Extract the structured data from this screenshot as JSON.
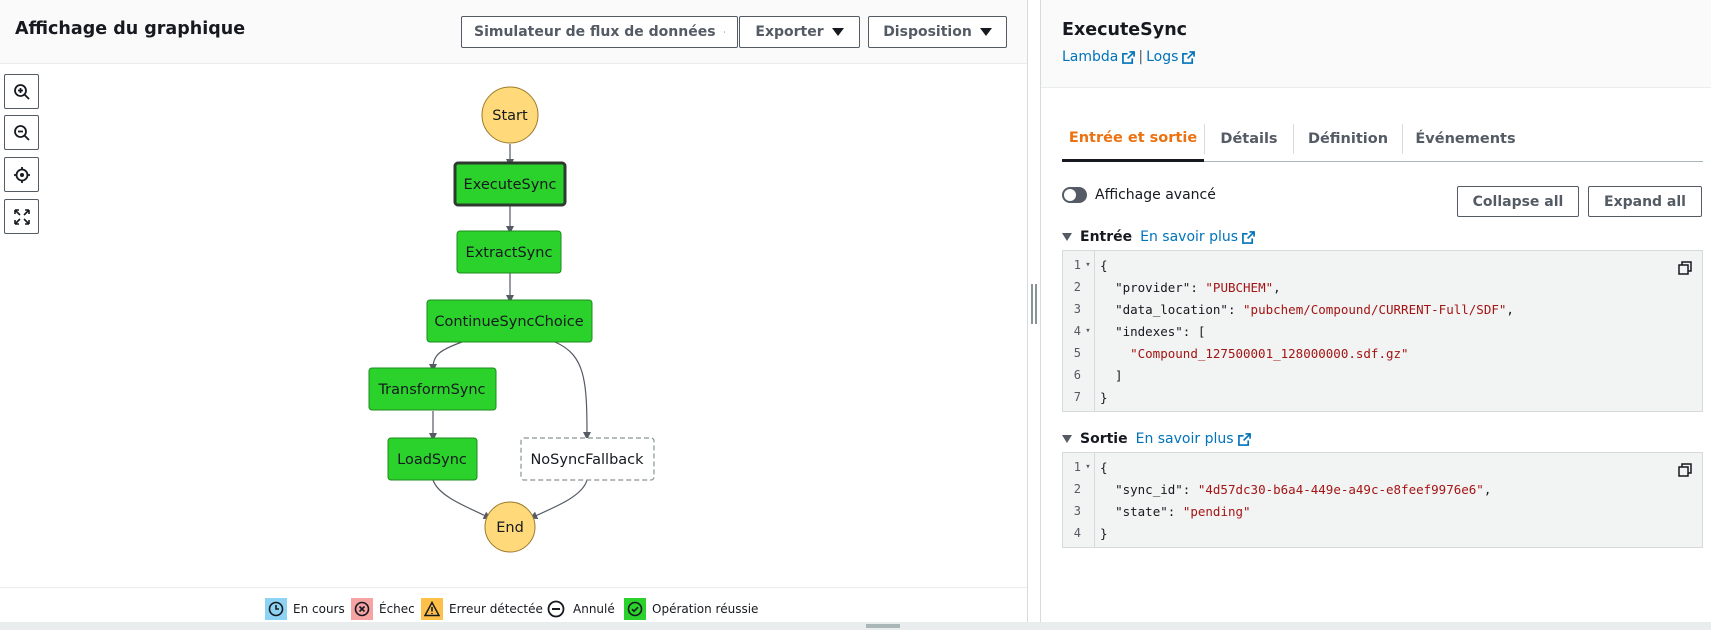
{
  "left_panel": {
    "title": "Affichage du graphique",
    "buttons": {
      "simulator": "Simulateur de flux de données",
      "export": "Exporter",
      "layout": "Disposition"
    },
    "graph": {
      "start": "Start",
      "end": "End",
      "states": {
        "execute": "ExecuteSync",
        "extract": "ExtractSync",
        "choice": "ContinueSyncChoice",
        "transform": "TransformSync",
        "load": "LoadSync",
        "fallback": "NoSyncFallback"
      }
    },
    "legend": {
      "in_progress": "En cours",
      "failed": "Échec",
      "caught_error": "Erreur détectée",
      "cancelled": "Annulé",
      "succeeded": "Opération réussie"
    }
  },
  "right_panel": {
    "title": "ExecuteSync",
    "links": {
      "lambda": "Lambda",
      "separator": "|",
      "logs": "Logs"
    },
    "tabs": [
      "Entrée et sortie",
      "Détails",
      "Définition",
      "Événements"
    ],
    "active_tab": "Entrée et sortie",
    "toggle_label": "Affichage avancé",
    "toggle_on": false,
    "collapse_all": "Collapse all",
    "expand_all": "Expand all",
    "input": {
      "label": "Entrée",
      "learn_more": "En savoir plus",
      "lines": [
        "{",
        "  \"provider\": \"PUBCHEM\",",
        "  \"data_location\": \"pubchem/Compound/CURRENT-Full/SDF\",",
        "  \"indexes\": [",
        "    \"Compound_127500001_128000000.sdf.gz\"",
        "  ]",
        "}"
      ]
    },
    "output": {
      "label": "Sortie",
      "learn_more": "En savoir plus",
      "lines": [
        "{",
        "  \"sync_id\": \"4d57dc30-b6a4-449e-a49c-e8feef9976e6\",",
        "  \"state\": \"pending\"",
        "}"
      ]
    }
  },
  "colors": {
    "success": "#2bd22b",
    "terminal": "#ffd97a",
    "accent_tab": "#ec7211",
    "link": "#0073bb"
  }
}
